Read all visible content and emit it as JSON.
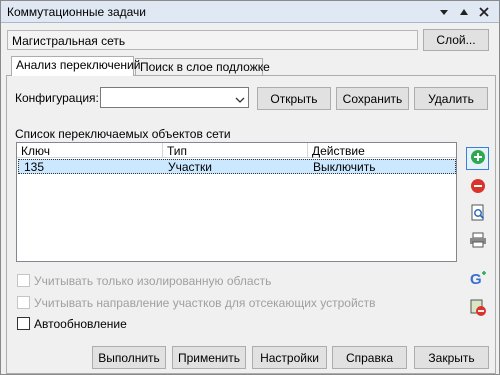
{
  "window": {
    "title": "Коммутационные задачи"
  },
  "network": {
    "name": "Магистральная сеть",
    "layer_button": "Слой..."
  },
  "tabs": [
    {
      "label": "Анализ переключений",
      "active": true
    },
    {
      "label": "Поиск в слое подложке",
      "active": false
    }
  ],
  "config": {
    "label": "Конфигурация:",
    "value": "",
    "open_button": "Открыть",
    "save_button": "Сохранить",
    "delete_button": "Удалить"
  },
  "list": {
    "title": "Список переключаемых объектов сети",
    "columns": [
      "Ключ",
      "Тип",
      "Действие"
    ],
    "rows": [
      {
        "key": "135",
        "type": "Участки",
        "action": "Выключить"
      }
    ]
  },
  "options": {
    "isolated_area": {
      "label": "Учитывать только изолированную область",
      "checked": false,
      "enabled": false
    },
    "direction": {
      "label": "Учитывать направление участков для отсекающих устройств",
      "checked": false,
      "enabled": false
    },
    "autoupdate": {
      "label": "Автообновление",
      "checked": false,
      "enabled": true
    }
  },
  "footer": {
    "execute": "Выполнить",
    "apply": "Применить",
    "settings": "Настройки",
    "help": "Справка",
    "close": "Закрыть"
  },
  "colors": {
    "titlebar": "#dfe8f3",
    "selection": "#cce8ff",
    "add_green": "#2fa84f",
    "remove_red": "#d9342b"
  }
}
